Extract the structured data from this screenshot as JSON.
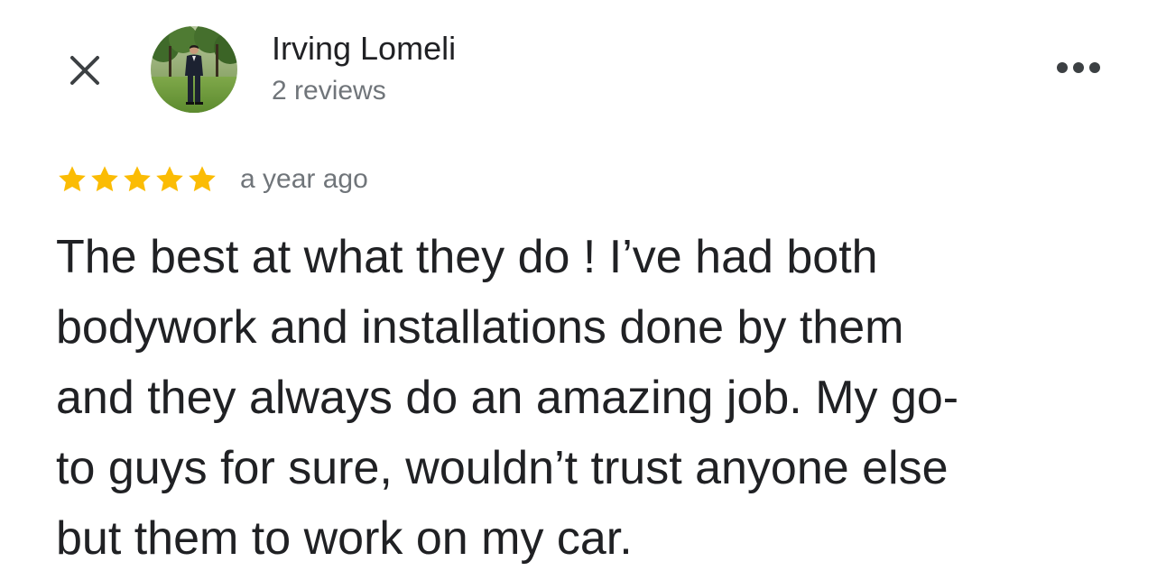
{
  "header": {
    "close_icon": "close-icon",
    "more_icon": "more-horizontal-icon"
  },
  "reviewer": {
    "name": "Irving Lomeli",
    "review_count": "2 reviews",
    "avatar_icon": "avatar-photo"
  },
  "review": {
    "rating": 5,
    "rating_max": 5,
    "star_color": "#fbbc04",
    "time_ago": "a year ago",
    "text_lines": [
      "The best at what they do ! I’ve had both",
      "bodywork and installations done by them",
      "and they always do an amazing job. My go-",
      "to guys for sure, wouldn’t trust anyone else",
      "but them to work on my car."
    ]
  }
}
